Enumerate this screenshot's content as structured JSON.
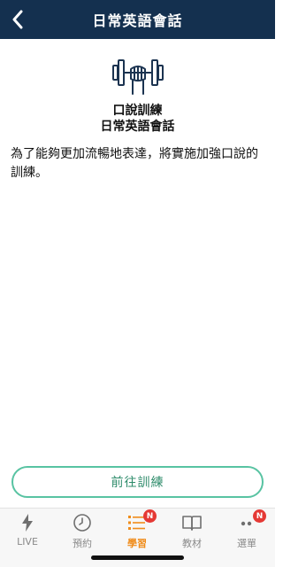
{
  "header": {
    "title": "日常英語會話"
  },
  "hero": {
    "heading_line1": "口說訓練",
    "heading_line2": "日常英語會話",
    "description": "為了能夠更加流暢地表達，將實施加強口說的訓練。"
  },
  "cta": {
    "label": "前往訓練"
  },
  "tabbar": {
    "tabs": [
      {
        "label": "LIVE",
        "icon": "lightning-icon"
      },
      {
        "label": "預約",
        "icon": "clock-icon"
      },
      {
        "label": "學習",
        "icon": "list-icon",
        "active": true,
        "badge": "N"
      },
      {
        "label": "教材",
        "icon": "book-icon"
      },
      {
        "label": "選單",
        "icon": "more-icon",
        "badge": "N"
      }
    ]
  },
  "colors": {
    "header_bg": "#14304f",
    "accent_green": "#58c3a2",
    "active_orange": "#f08c1a",
    "badge_red": "#e53935"
  }
}
